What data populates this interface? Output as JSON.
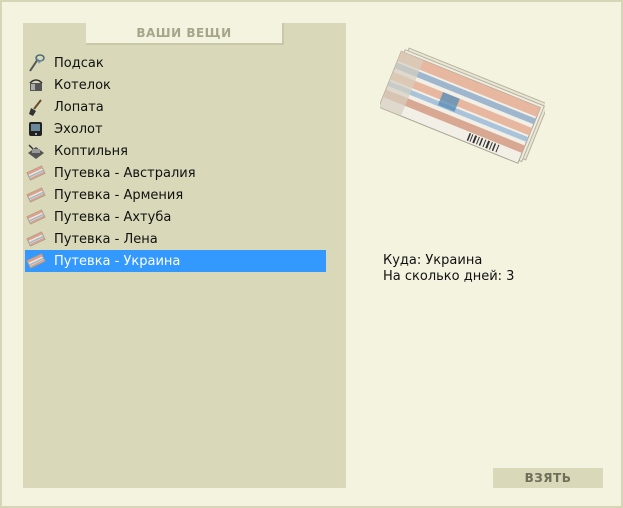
{
  "panel_title": "ВАШИ ВЕЩИ",
  "items": [
    {
      "label": "Подсак",
      "icon": "landing-net-icon"
    },
    {
      "label": "Котелок",
      "icon": "pot-icon"
    },
    {
      "label": "Лопата",
      "icon": "shovel-icon"
    },
    {
      "label": "Эхолот",
      "icon": "echo-sounder-icon"
    },
    {
      "label": "Коптильня",
      "icon": "smokehouse-icon"
    },
    {
      "label": "Путевка - Австралия",
      "icon": "voucher-icon"
    },
    {
      "label": "Путевка - Армения",
      "icon": "voucher-icon"
    },
    {
      "label": "Путевка - Ахтуба",
      "icon": "voucher-icon"
    },
    {
      "label": "Путевка - Лена",
      "icon": "voucher-icon"
    },
    {
      "label": "Путевка - Украина",
      "icon": "voucher-icon",
      "selected": true
    }
  ],
  "details": {
    "destination": "Куда: Украина",
    "days": "На сколько дней: 3"
  },
  "take_button": "ВЗЯТЬ"
}
